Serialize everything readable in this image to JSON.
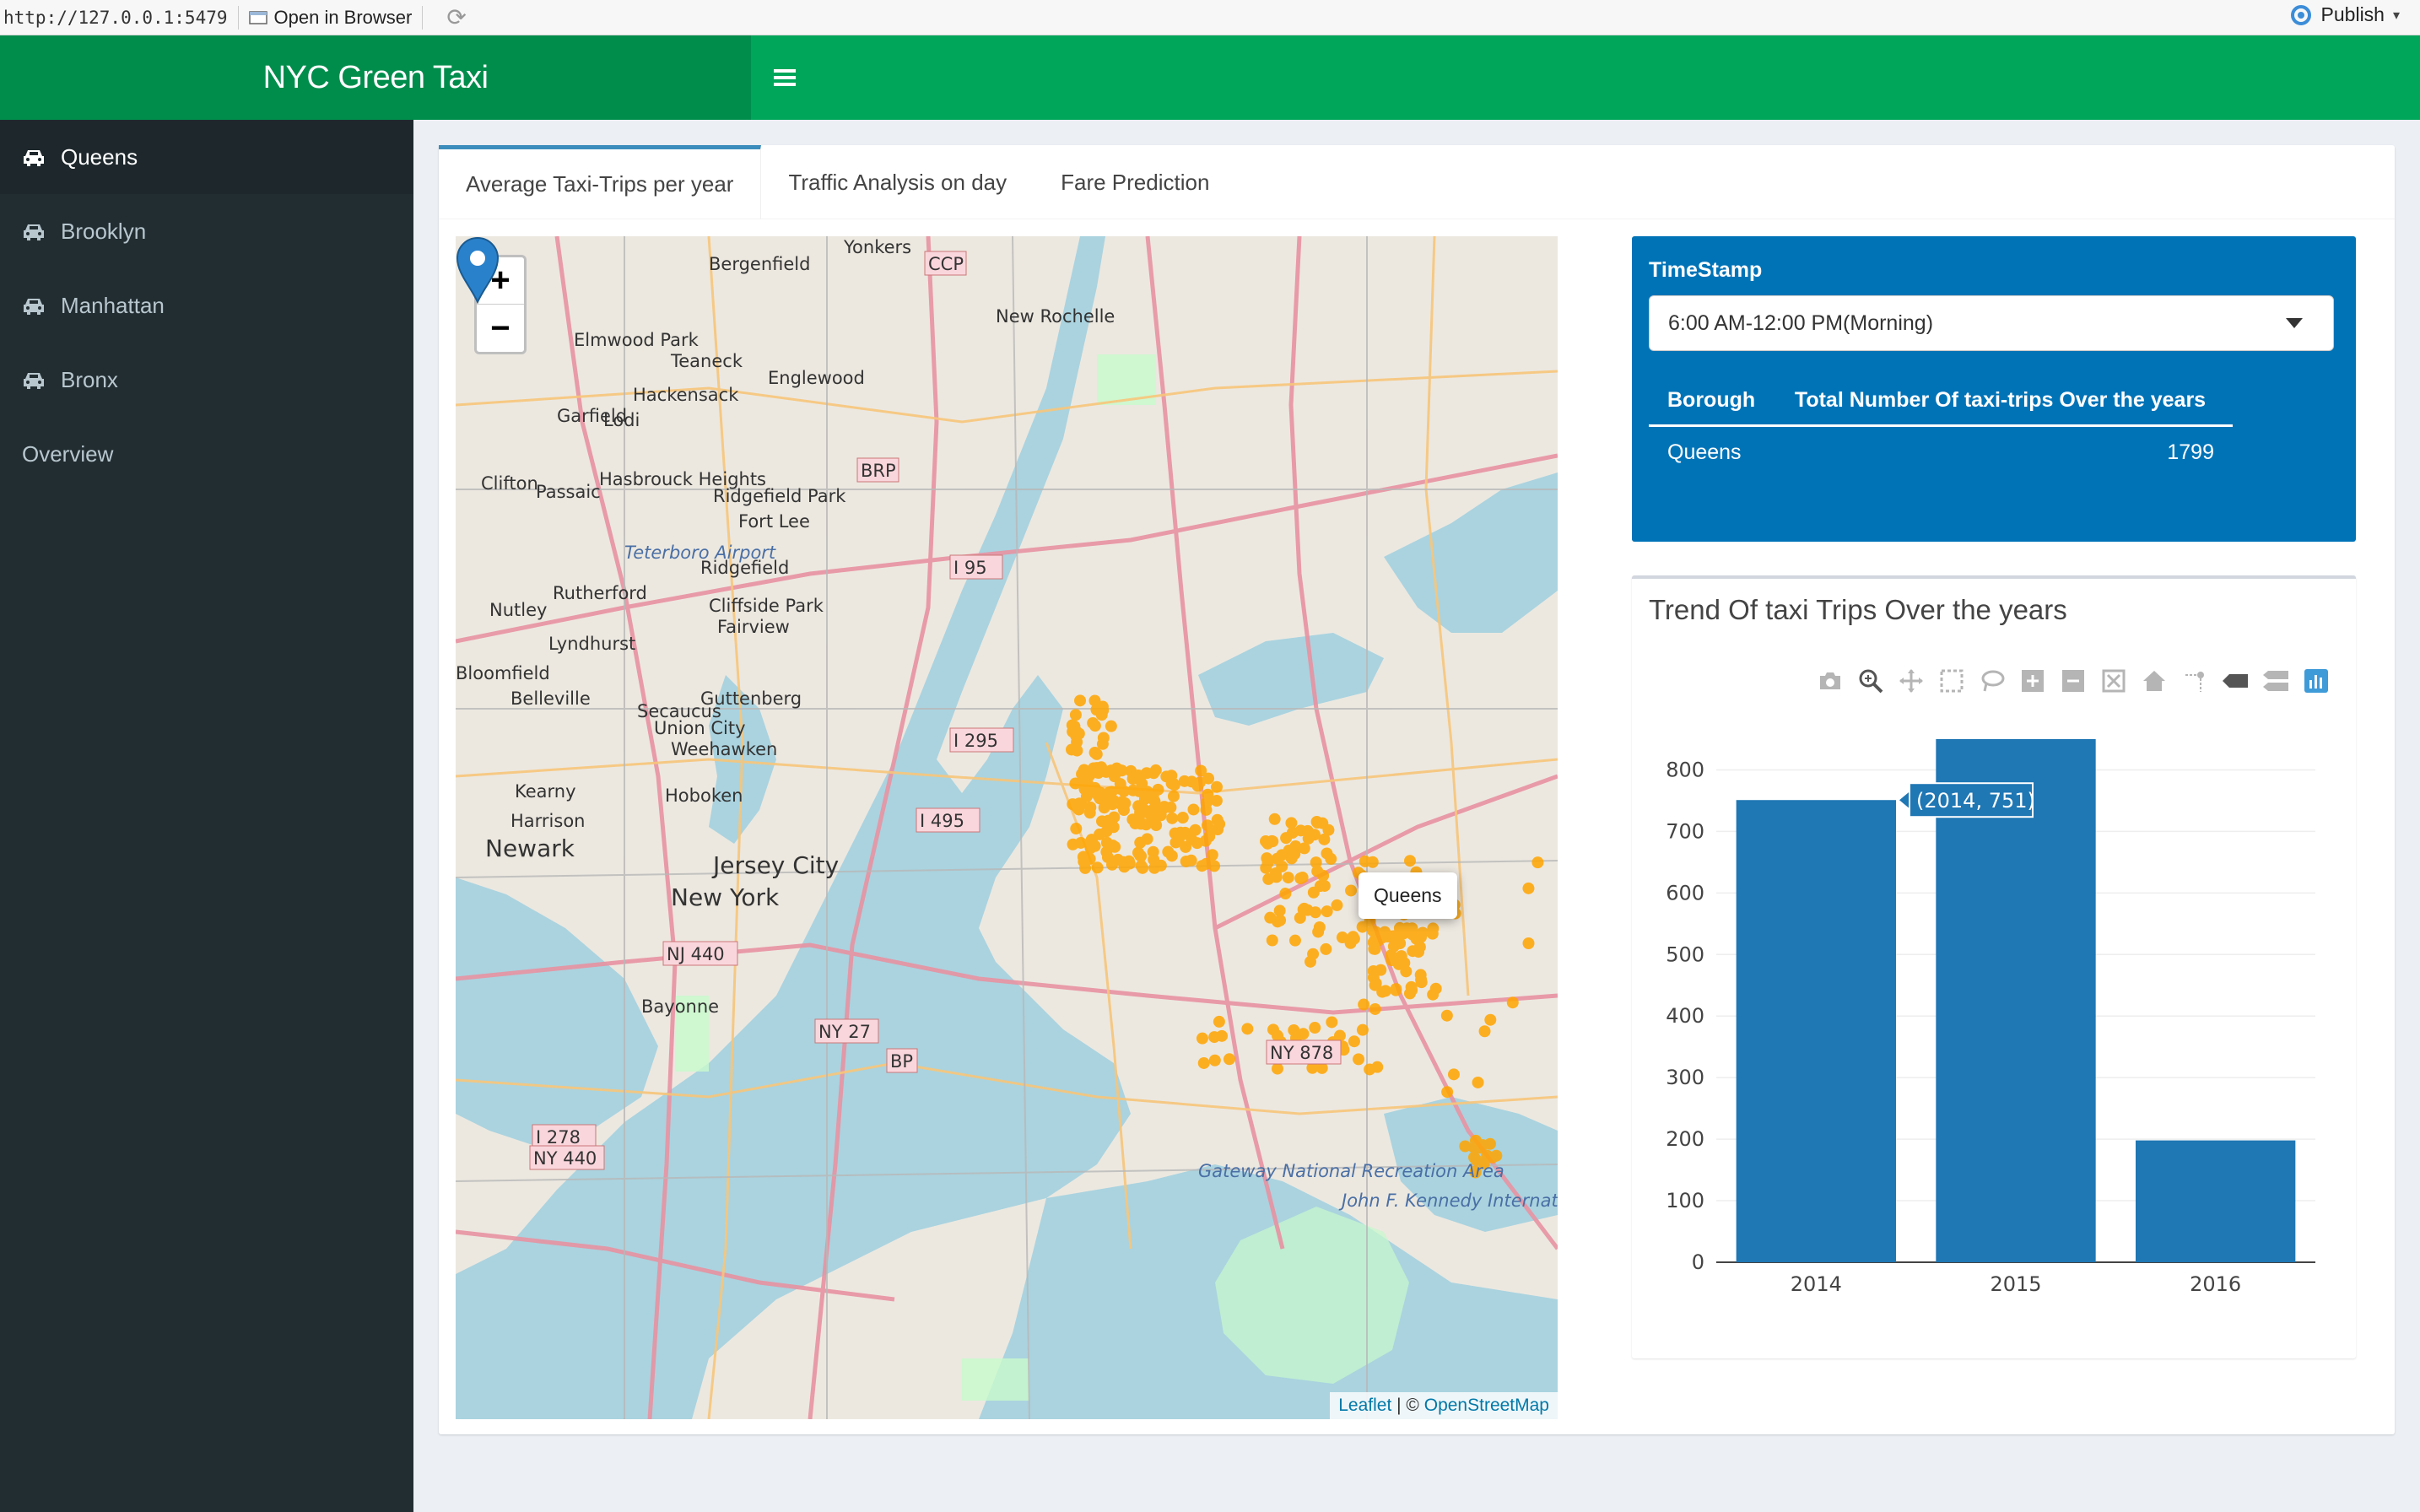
{
  "viewer": {
    "url": "http://127.0.0.1:5479",
    "open_in_browser": "Open in Browser",
    "publish": "Publish"
  },
  "header": {
    "title": "NYC Green Taxi",
    "toggle_icon": "hamburger-icon"
  },
  "sidebar": {
    "items": [
      {
        "label": "Queens",
        "icon": "car-icon",
        "active": true
      },
      {
        "label": "Brooklyn",
        "icon": "car-icon",
        "active": false
      },
      {
        "label": "Manhattan",
        "icon": "car-icon",
        "active": false
      },
      {
        "label": "Bronx",
        "icon": "car-icon",
        "active": false
      },
      {
        "label": "Overview",
        "icon": "",
        "active": false
      }
    ]
  },
  "tabs": [
    {
      "label": "Average Taxi-Trips per year",
      "active": true
    },
    {
      "label": "Traffic Analysis on day",
      "active": false
    },
    {
      "label": "Fare Prediction",
      "active": false
    }
  ],
  "map": {
    "zoom_in": "+",
    "zoom_out": "−",
    "popup": "Queens",
    "attribution_leaflet": "Leaflet",
    "attribution_sep": " | © ",
    "attribution_osm": "OpenStreetMap",
    "place_labels": [
      "Bergenfield",
      "Yonkers",
      "CCP",
      "New Rochelle",
      "Elmwood Park",
      "Teaneck",
      "Englewood",
      "Hackensack",
      "Garfield",
      "Lodi",
      "Passaic",
      "Clifton",
      "Hasbrouck Heights",
      "Ridgefield Park",
      "Fort Lee",
      "BRP",
      "Teterboro Airport",
      "Ridgefield",
      "I 95",
      "Nutley",
      "Rutherford",
      "Cliffside Park",
      "Fairview",
      "Lyndhurst",
      "Bloomfield",
      "Belleville",
      "Secaucus",
      "Guttenberg",
      "Union City",
      "Weehawken",
      "Kearny",
      "I 295",
      "Harrison",
      "Newark",
      "Hoboken",
      "Jersey City",
      "New York",
      "I 495",
      "NJ 440",
      "Bayonne",
      "NY 27",
      "NY 878",
      "BP",
      "I 278",
      "NY 440",
      "Gateway National Recreation Area",
      "John F. Kennedy International Airport"
    ]
  },
  "timestamp": {
    "label": "TimeStamp",
    "selected": "6:00 AM-12:00 PM(Morning)",
    "table": {
      "columns": [
        "Borough",
        "Total Number Of taxi-trips Over the years"
      ],
      "rows": [
        [
          "Queens",
          "1799"
        ]
      ]
    }
  },
  "trend": {
    "title": "Trend Of taxi Trips Over the years",
    "modebar": [
      "camera-icon",
      "zoom-icon",
      "pan-icon",
      "box-select-icon",
      "lasso-icon",
      "zoom-in-icon",
      "zoom-out-icon",
      "autoscale-icon",
      "reset-axes-icon",
      "spike-lines-icon",
      "hover-closest-icon",
      "hover-compare-icon",
      "plotly-logo-icon"
    ],
    "tooltip": "(2014, 751)"
  },
  "chart_data": {
    "type": "bar",
    "categories": [
      "2014",
      "2015",
      "2016"
    ],
    "values": [
      751,
      850,
      198
    ],
    "ylim": [
      0,
      850
    ],
    "yticks": [
      0,
      100,
      200,
      300,
      400,
      500,
      600,
      700,
      800
    ],
    "color": "#1f77b4",
    "title": "",
    "xlabel": "",
    "ylabel": ""
  },
  "colors": {
    "header": "#00a65a",
    "logo_bg": "#008d4c",
    "sidebar": "#222d32",
    "box_blue": "#0073b7",
    "trip_points": "#ffa500"
  }
}
